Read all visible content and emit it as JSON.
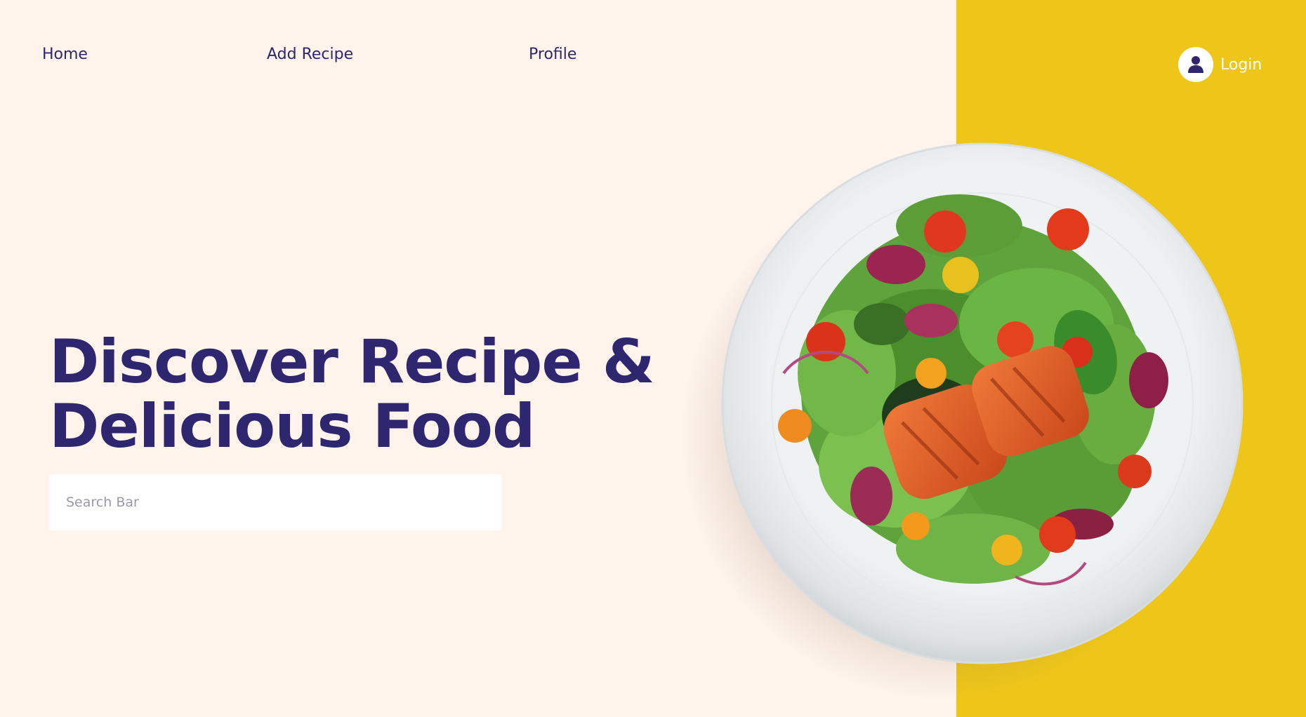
{
  "nav": {
    "home": "Home",
    "add_recipe": "Add Recipe",
    "profile": "Profile",
    "login": "Login"
  },
  "hero": {
    "headline_line1": "Discover Recipe &",
    "headline_line2": "Delicious Food",
    "search_placeholder": "Search Bar"
  },
  "colors": {
    "background": "#fff4ec",
    "accent_yellow": "#eec619",
    "primary_navy": "#2e266f"
  },
  "icons": {
    "login": "user-icon"
  }
}
